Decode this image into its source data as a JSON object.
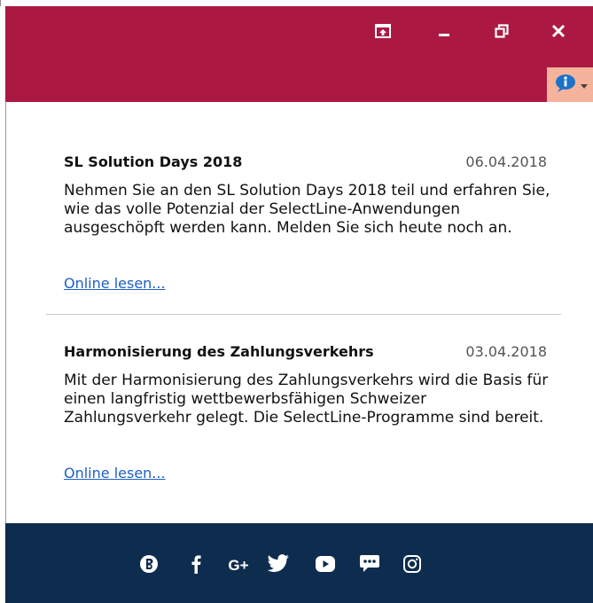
{
  "window": {
    "buttons": [
      "pin-icon",
      "minimize-icon",
      "restore-icon",
      "close-icon"
    ],
    "header_color": "#ab1942",
    "info_button_color": "#f5b39c"
  },
  "news": [
    {
      "title": "SL Solution Days 2018",
      "date": "06.04.2018",
      "body": "Nehmen Sie an den SL Solution Days 2018 teil und erfahren Sie, wie das volle Potenzial der SelectLine-Anwendungen ausgeschöpft werden kann. Melden Sie sich heute noch an.",
      "link": "Online lesen..."
    },
    {
      "title": "Harmonisierung des Zahlungsverkehrs",
      "date": "03.04.2018",
      "body": "Mit der Harmonisierung des Zahlungsverkehrs wird die Basis für einen langfristig wettbewerbsfähigen Schweizer Zahlungsverkehr gelegt. Die SelectLine-Programme sind bereit.",
      "link": "Online lesen..."
    }
  ],
  "footer": {
    "color": "#0e2c4d",
    "social_icons": [
      "blog-icon",
      "facebook-icon",
      "google-plus-icon",
      "twitter-icon",
      "youtube-icon",
      "forum-icon",
      "instagram-icon"
    ],
    "google_plus_label": "G+"
  }
}
